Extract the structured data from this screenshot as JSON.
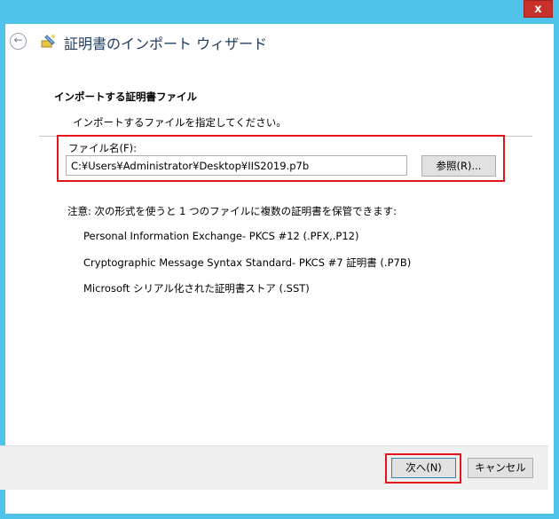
{
  "window": {
    "close_label": "x"
  },
  "header": {
    "title": "証明書のインポート ウィザード",
    "back_icon": "back-arrow-icon",
    "wizard_icon": "certificate-wizard-icon"
  },
  "page": {
    "section_title": "インポートする証明書ファイル",
    "section_subtitle": "インポートするファイルを指定してください。",
    "file_label": "ファイル名(F):",
    "file_value": "C:¥Users¥Administrator¥Desktop¥IIS2019.p7b",
    "browse_label": "参照(R)...",
    "note": "注意: 次の形式を使うと 1 つのファイルに複数の証明書を保管できます:",
    "formats": [
      "Personal Information Exchange- PKCS #12 (.PFX,.P12)",
      "Cryptographic Message Syntax Standard- PKCS #7 証明書 (.P7B)",
      "Microsoft シリアル化された証明書ストア (.SST)"
    ]
  },
  "footer": {
    "next_label": "次へ(N)",
    "cancel_label": "キャンセル"
  },
  "colors": {
    "frame": "#4fc3ea",
    "highlight": "#e5141a",
    "close": "#c7312a"
  }
}
